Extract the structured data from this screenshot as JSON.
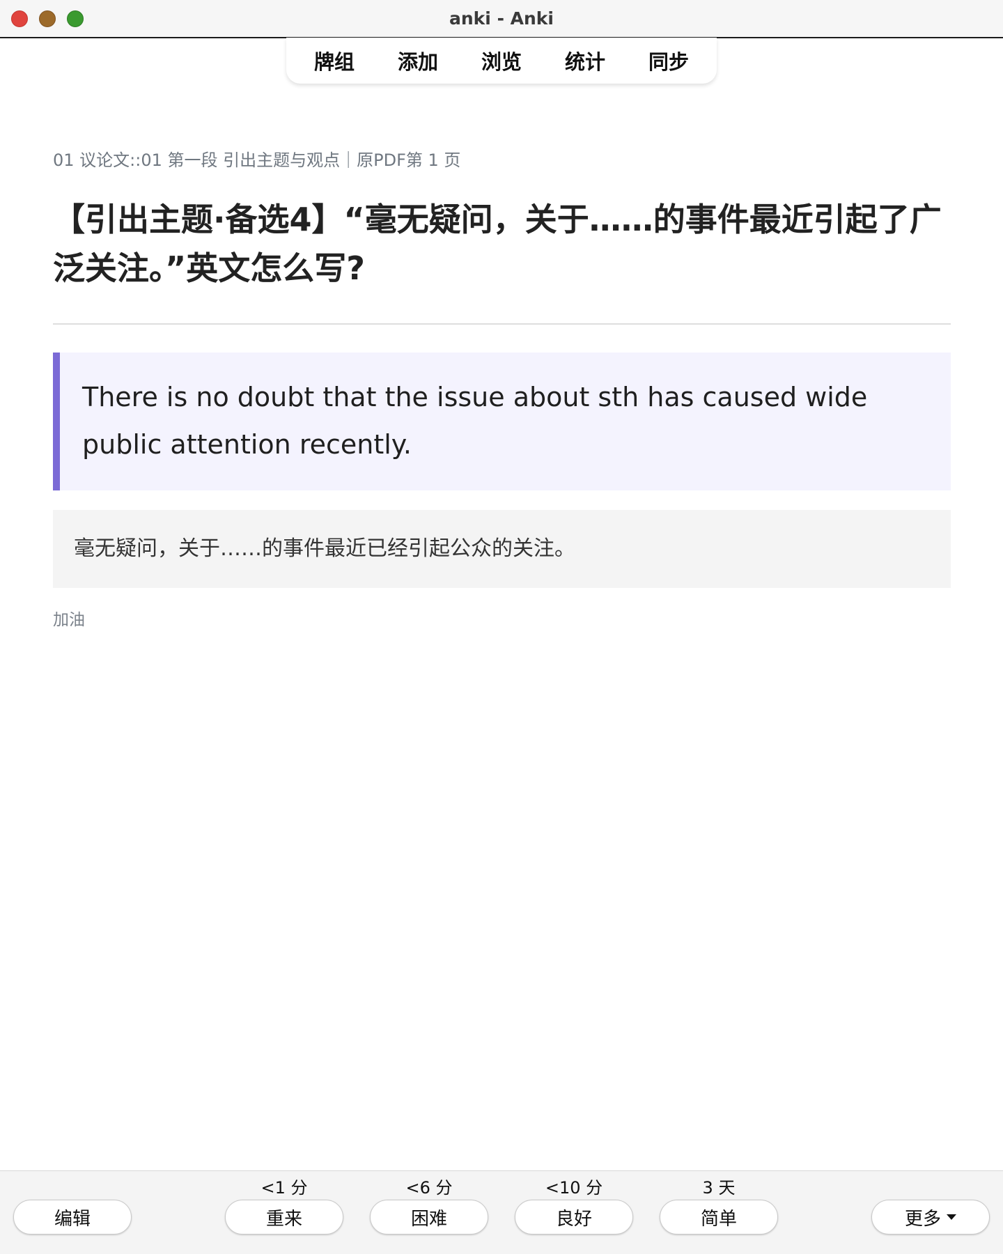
{
  "window": {
    "title": "anki - Anki"
  },
  "toolbar": {
    "items": [
      {
        "label": "牌组"
      },
      {
        "label": "添加"
      },
      {
        "label": "浏览"
      },
      {
        "label": "统计"
      },
      {
        "label": "同步"
      }
    ]
  },
  "card": {
    "deck_path": "01 议论文::01 第一段 引出主题与观点｜原PDF第 1 页",
    "question": "【引出主题·备选4】“毫无疑问，关于……的事件最近引起了广泛关注。”英文怎么写?",
    "answer": "There is no doubt that the issue about sth has caused wide public attention recently.",
    "translation": "毫无疑问，关于……的事件最近已经引起公众的关注。",
    "tag": "加油"
  },
  "bottom": {
    "edit_label": "编辑",
    "more_label": "更多",
    "answers": [
      {
        "interval": "<1 分",
        "label": "重来"
      },
      {
        "interval": "<6 分",
        "label": "困难"
      },
      {
        "interval": "<10 分",
        "label": "良好"
      },
      {
        "interval": "3 天",
        "label": "简单"
      }
    ]
  },
  "colors": {
    "accent_border": "#7b6ad6",
    "answer_bg": "#f4f3fe",
    "translation_bg": "#f4f4f4",
    "close": "#e0443e",
    "minimize": "#9c6a2a",
    "maximize": "#3a9a2f"
  }
}
